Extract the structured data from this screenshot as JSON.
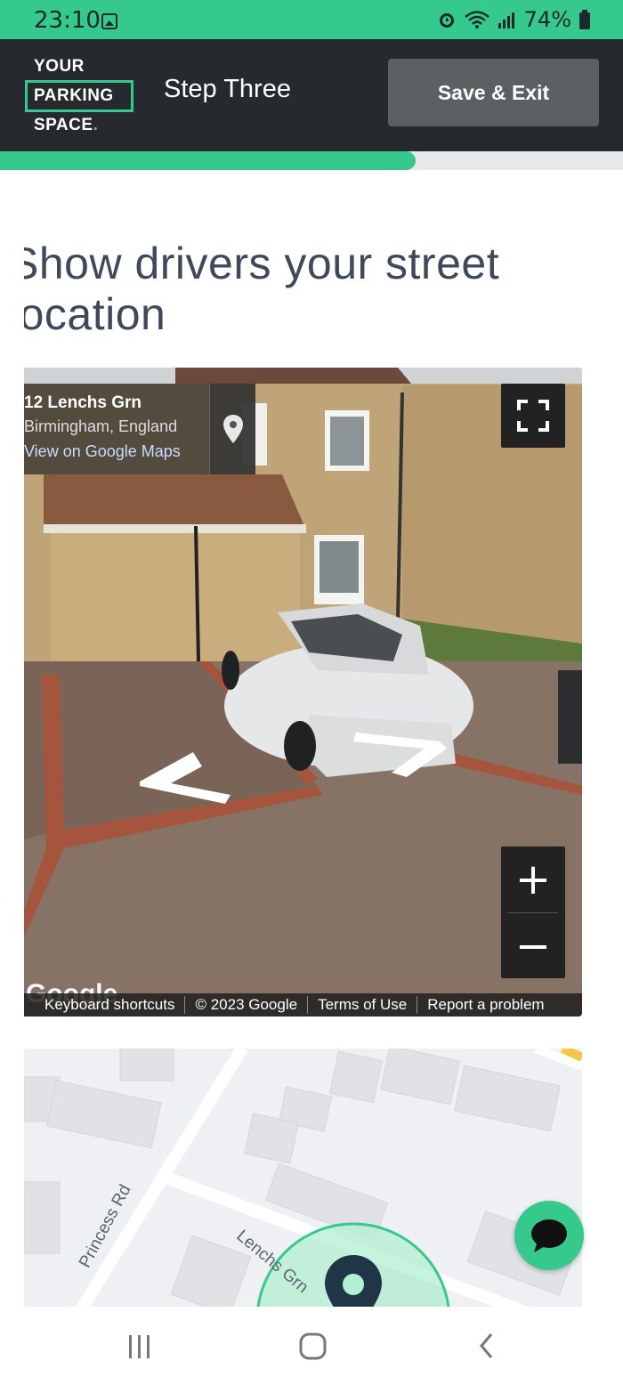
{
  "status_bar": {
    "time": "23:10",
    "battery": "74%",
    "icons": [
      "image-icon",
      "alarm-icon",
      "wifi-icon",
      "signal-icon",
      "battery-icon"
    ]
  },
  "header": {
    "logo": {
      "line1": "YOUR",
      "line2": "PARKING",
      "line3": "SPACE",
      "dot": "."
    },
    "step_title": "Step Three",
    "save_exit_label": "Save & Exit"
  },
  "progress": {
    "value": 0.667
  },
  "page": {
    "heading": "Show drivers your street location"
  },
  "street_view": {
    "address": "12 Lenchs Grn",
    "city": "Birmingham, England",
    "link": "View on Google Maps",
    "watermark": "Google",
    "footer": {
      "keyboard": "Keyboard shortcuts",
      "copyright": "© 2023 Google",
      "terms": "Terms of Use",
      "report": "Report a problem"
    },
    "zoom_in": "+",
    "zoom_out": "−"
  },
  "map": {
    "roads": {
      "princess": "Princess Rd",
      "lenchs": "Lenchs Grn"
    }
  },
  "colors": {
    "brand_green": "#35c98d",
    "header_dark": "#262a2e",
    "heading_text": "#3e4a5c"
  }
}
